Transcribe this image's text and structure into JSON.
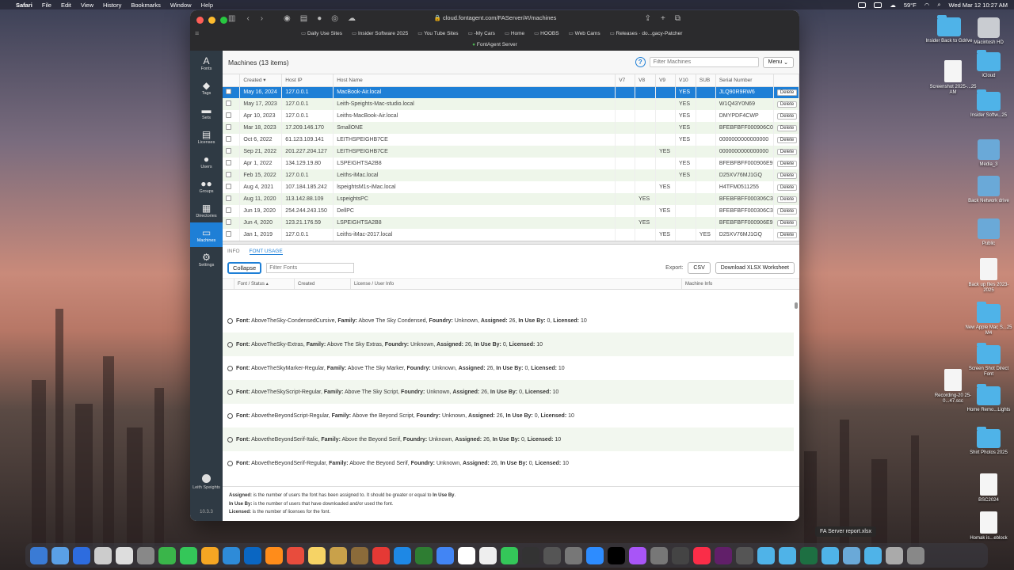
{
  "menubar": {
    "app": "Safari",
    "items": [
      "File",
      "Edit",
      "View",
      "History",
      "Bookmarks",
      "Window",
      "Help"
    ],
    "weather": "59°F",
    "datetime": "Wed Mar 12  10:27 AM"
  },
  "browser": {
    "url": "cloud.fontagent.com/FAServer/#!/machines",
    "favorites": [
      "Daily Use Sites",
      "Insider Software 2025",
      "You Tube Sites",
      "-My Cars",
      "Home",
      "HOOBS",
      "Web Cams",
      "Releases · do...gacy-Patcher"
    ],
    "tab_title": "FontAgent Server"
  },
  "fa_sidebar": {
    "items": [
      {
        "label": "Fonts",
        "icon": "font-icon"
      },
      {
        "label": "Tags",
        "icon": "tag-icon"
      },
      {
        "label": "Sets",
        "icon": "folder-icon"
      },
      {
        "label": "Licenses",
        "icon": "license-icon"
      },
      {
        "label": "Users",
        "icon": "user-icon"
      },
      {
        "label": "Groups",
        "icon": "group-icon"
      },
      {
        "label": "Directories",
        "icon": "directory-icon"
      },
      {
        "label": "Machines",
        "icon": "laptop-icon"
      },
      {
        "label": "Settings",
        "icon": "gear-icon"
      }
    ],
    "user": "Leith Speights",
    "version": "10.3.3"
  },
  "machines": {
    "title": "Machines (13 items)",
    "filter_placeholder": "Filter Machines",
    "menu_label": "Menu",
    "columns": [
      "Created",
      "Host IP",
      "Host Name",
      "V7",
      "V8",
      "V9",
      "V10",
      "SUB",
      "Serial Number"
    ],
    "delete_label": "Delete",
    "rows": [
      {
        "created": "May 16, 2024",
        "ip": "127.0.0.1",
        "host": "MacBook-Air.local",
        "v7": "",
        "v8": "",
        "v9": "",
        "v10": "YES",
        "sub": "",
        "serial": "JLQ90R9RW6"
      },
      {
        "created": "May 17, 2023",
        "ip": "127.0.0.1",
        "host": "Leith-Speights-Mac-studio.local",
        "v7": "",
        "v8": "",
        "v9": "",
        "v10": "YES",
        "sub": "",
        "serial": "W1Q43Y0N69"
      },
      {
        "created": "Apr 10, 2023",
        "ip": "127.0.0.1",
        "host": "Leiths-MacBook-Air.local",
        "v7": "",
        "v8": "",
        "v9": "",
        "v10": "YES",
        "sub": "",
        "serial": "DMYPDF4CWP"
      },
      {
        "created": "Mar 18, 2023",
        "ip": "17.209.146.170",
        "host": "SmallONE",
        "v7": "",
        "v8": "",
        "v9": "",
        "v10": "YES",
        "sub": "",
        "serial": "BFEBFBFF000906C0"
      },
      {
        "created": "Oct 6, 2022",
        "ip": "61.123.109.141",
        "host": "LEITHSPEIGHB7CE",
        "v7": "",
        "v8": "",
        "v9": "",
        "v10": "YES",
        "sub": "",
        "serial": "0000000000000000"
      },
      {
        "created": "Sep 21, 2022",
        "ip": "201.227.204.127",
        "host": "LEITHSPEIGHB7CE",
        "v7": "",
        "v8": "",
        "v9": "YES",
        "v10": "",
        "sub": "",
        "serial": "0000000000000000"
      },
      {
        "created": "Apr 1, 2022",
        "ip": "134.129.19.80",
        "host": "LSPEIGHTSA2B8",
        "v7": "",
        "v8": "",
        "v9": "",
        "v10": "YES",
        "sub": "",
        "serial": "BFEBFBFF000906E9"
      },
      {
        "created": "Feb 15, 2022",
        "ip": "127.0.0.1",
        "host": "Leiths-iMac.local",
        "v7": "",
        "v8": "",
        "v9": "",
        "v10": "YES",
        "sub": "",
        "serial": "D25XV76MJ1GQ"
      },
      {
        "created": "Aug 4, 2021",
        "ip": "107.184.185.242",
        "host": "lspeightsM1s-iMac.local",
        "v7": "",
        "v8": "",
        "v9": "YES",
        "v10": "",
        "sub": "",
        "serial": "H4TFM0511255"
      },
      {
        "created": "Aug 11, 2020",
        "ip": "113.142.88.109",
        "host": "LspeightsPC",
        "v7": "",
        "v8": "YES",
        "v9": "",
        "v10": "",
        "sub": "",
        "serial": "BFEBFBFF000306C3"
      },
      {
        "created": "Jun 19, 2020",
        "ip": "254.244.243.150",
        "host": "DellPC",
        "v7": "",
        "v8": "",
        "v9": "YES",
        "v10": "",
        "sub": "",
        "serial": "BFEBFBFF000306C3"
      },
      {
        "created": "Jun 4, 2020",
        "ip": "123.21.176.59",
        "host": "LSPEIGHTSA2B8",
        "v7": "",
        "v8": "YES",
        "v9": "",
        "v10": "",
        "sub": "",
        "serial": "BFEBFBFF000906E9"
      },
      {
        "created": "Jan 1, 2019",
        "ip": "127.0.0.1",
        "host": "Leiths-iMac-2017.local",
        "v7": "",
        "v8": "",
        "v9": "YES",
        "v10": "",
        "sub": "YES",
        "serial": "D25XV76MJ1GQ"
      }
    ]
  },
  "detail": {
    "tabs": [
      "INFO",
      "FONT USAGE"
    ],
    "collapse_label": "Collapse",
    "filter_fonts_placeholder": "Filter Fonts",
    "export_label": "Export:",
    "csv_label": "CSV",
    "xlsx_label": "Download XLSX Worksheet",
    "columns": [
      "Font / Status",
      "Created",
      "License / User Info",
      "Machine Info"
    ],
    "fonts": [
      {
        "font": "AboveTheSky-CondensedCursive",
        "family": "Above The Sky Condensed",
        "foundry": "Unknown",
        "assigned": "26",
        "in_use_by": "0",
        "licensed": "10"
      },
      {
        "font": "AboveTheSky-Extras",
        "family": "Above The Sky Extras",
        "foundry": "Unknown",
        "assigned": "26",
        "in_use_by": "0",
        "licensed": "10"
      },
      {
        "font": "AboveTheSkyMarker-Regular",
        "family": "Above The Sky Marker",
        "foundry": "Unknown",
        "assigned": "26",
        "in_use_by": "0",
        "licensed": "10"
      },
      {
        "font": "AboveTheSkyScript-Regular",
        "family": "Above The Sky Script",
        "foundry": "Unknown",
        "assigned": "26",
        "in_use_by": "0",
        "licensed": "10"
      },
      {
        "font": "AbovetheBeyondScript-Regular",
        "family": "Above the Beyond Script",
        "foundry": "Unknown",
        "assigned": "26",
        "in_use_by": "0",
        "licensed": "10"
      },
      {
        "font": "AbovetheBeyondSerif-Italic",
        "family": "Above the Beyond Serif",
        "foundry": "Unknown",
        "assigned": "26",
        "in_use_by": "0",
        "licensed": "10"
      },
      {
        "font": "AbovetheBeyondSerif-Regular",
        "family": "Above the Beyond Serif",
        "foundry": "Unknown",
        "assigned": "26",
        "in_use_by": "0",
        "licensed": "10"
      }
    ],
    "labels": {
      "font": "Font:",
      "family": "Family:",
      "foundry": "Foundry:",
      "assigned": "Assigned:",
      "in_use_by": "In Use By:",
      "licensed": "Licensed:"
    },
    "legend": {
      "assigned_term": "Assigned:",
      "assigned_text": " is the number of users the font has been assigned to. It should be greater or equal to ",
      "assigned_ref": "In Use By",
      "in_use_term": "In Use By:",
      "in_use_text": " is the number of users that have downloaded and/or used the font.",
      "licensed_term": "Licensed:",
      "licensed_text": " is the number of licenses for the font."
    }
  },
  "desktop_icons": [
    {
      "label": "Macintosh HD",
      "kind": "disk"
    },
    {
      "label": "Insider Back to Gdrive",
      "kind": "folder"
    },
    {
      "label": "iCloud",
      "kind": "folder"
    },
    {
      "label": "Screenshot 2025-...25 AM",
      "kind": "doc"
    },
    {
      "label": "Insider Softw...25",
      "kind": "folder"
    },
    {
      "label": "Media_3",
      "kind": "net"
    },
    {
      "label": "Back Network drive",
      "kind": "net"
    },
    {
      "label": "Public",
      "kind": "net"
    },
    {
      "label": "Back up files 2023-2025",
      "kind": "doc"
    },
    {
      "label": "New Apple Mac S...25 M4",
      "kind": "folder"
    },
    {
      "label": "Screen Shot Direct Font",
      "kind": "folder"
    },
    {
      "label": "Recording-20 25-0...47.scc",
      "kind": "doc"
    },
    {
      "label": "Home Remo...Lights",
      "kind": "folder"
    },
    {
      "label": "Shirt Photos 2025",
      "kind": "folder"
    },
    {
      "label": "BSC2024",
      "kind": "doc"
    },
    {
      "label": "Homak is...eblock",
      "kind": "doc"
    }
  ],
  "tooltip": "FA Server report.xlsx",
  "colors": {
    "accent": "#1e7fd6",
    "sidebar": "#2f3a44",
    "row_alt": "#eef6ea"
  }
}
